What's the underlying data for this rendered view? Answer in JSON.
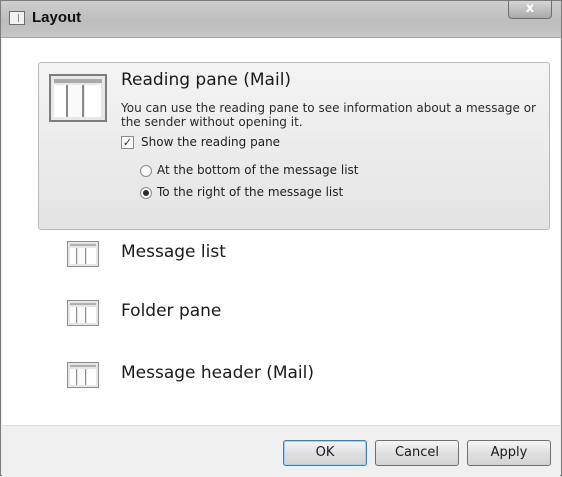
{
  "window": {
    "title": "Layout",
    "close_glyph": "x"
  },
  "reading_pane": {
    "title": "Reading pane (Mail)",
    "description": "You can use the reading pane to see information about a message or the sender without opening it.",
    "show_checkbox": {
      "label": "Show the reading pane",
      "checked": true,
      "glyph": "✓"
    },
    "options": [
      {
        "label": "At the bottom of the message list",
        "checked": false
      },
      {
        "label": "To the right of the message list",
        "checked": true
      }
    ]
  },
  "layout_items": [
    {
      "label": "Message list",
      "icon": "layout-icon"
    },
    {
      "label": "Folder pane",
      "icon": "layout-icon"
    },
    {
      "label": "Message header (Mail)",
      "icon": "layout-icon"
    }
  ],
  "buttons": {
    "ok": "OK",
    "cancel": "Cancel",
    "apply": "Apply"
  }
}
